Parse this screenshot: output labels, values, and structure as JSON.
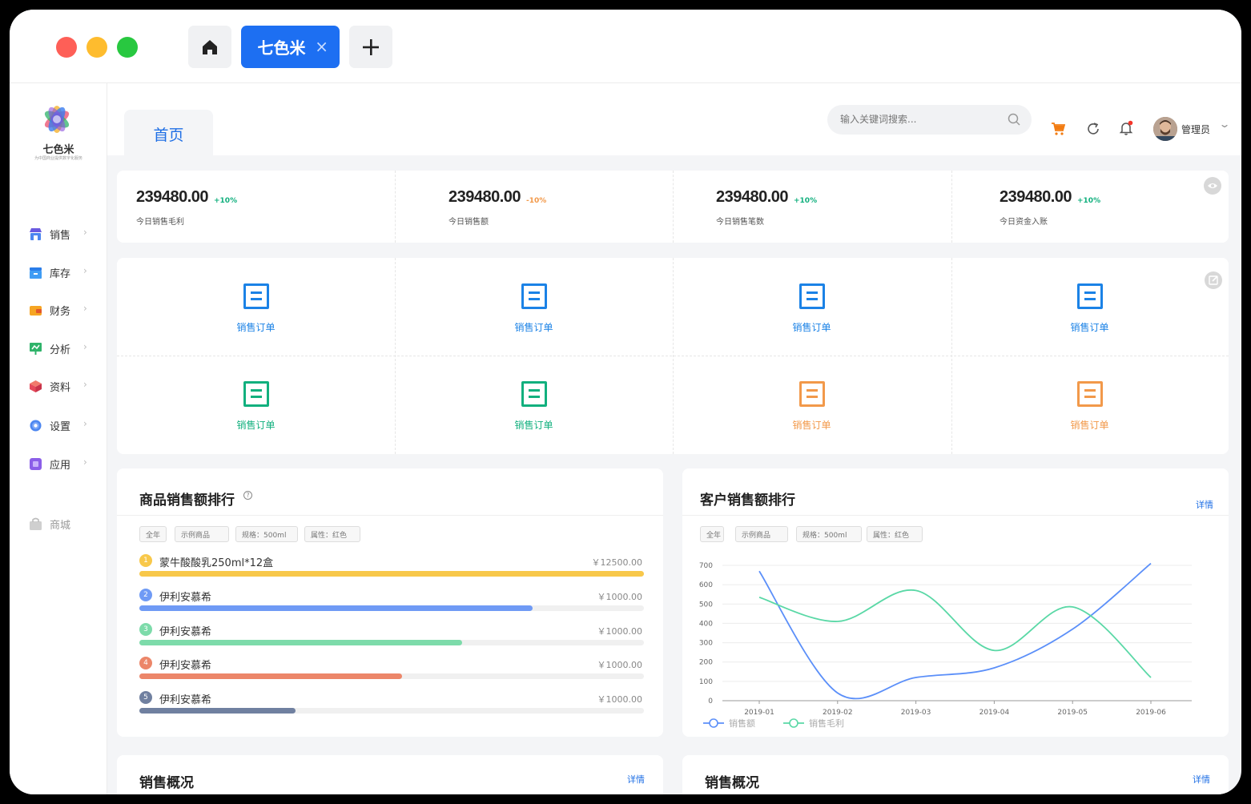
{
  "window": {
    "tabs": [
      {
        "label": "七色米"
      }
    ],
    "colors": {
      "accent": "#1d6ff2",
      "red": "#fe5f57",
      "yellow": "#febc2e",
      "green": "#28c840"
    }
  },
  "brand": {
    "name": "七色米",
    "slogan": "为中国商业提供数字化服务"
  },
  "sidebar": {
    "items": [
      {
        "label": "销售",
        "icon": "store-icon"
      },
      {
        "label": "库存",
        "icon": "box-icon"
      },
      {
        "label": "财务",
        "icon": "wallet-icon"
      },
      {
        "label": "分析",
        "icon": "chart-board-icon"
      },
      {
        "label": "资料",
        "icon": "cube-icon"
      },
      {
        "label": "设置",
        "icon": "gear-icon"
      },
      {
        "label": "应用",
        "icon": "app-icon"
      }
    ],
    "extra": {
      "label": "商城",
      "icon": "bag-icon"
    }
  },
  "header": {
    "page_tab": "首页",
    "search_placeholder": "输入关键词搜索...",
    "user": "管理员"
  },
  "stats": [
    {
      "value": "239480.00",
      "delta": "+10%",
      "trend": "up",
      "label": "今日销售毛利"
    },
    {
      "value": "239480.00",
      "delta": "-10%",
      "trend": "down",
      "label": "今日销售额"
    },
    {
      "value": "239480.00",
      "delta": "+10%",
      "trend": "up",
      "label": "今日销售笔数"
    },
    {
      "value": "239480.00",
      "delta": "+10%",
      "trend": "up",
      "label": "今日资金入账"
    }
  ],
  "quick": [
    {
      "label": "销售订单",
      "color": "#1b82e6"
    },
    {
      "label": "销售订单",
      "color": "#1b82e6"
    },
    {
      "label": "销售订单",
      "color": "#1b82e6"
    },
    {
      "label": "销售订单",
      "color": "#1b82e6"
    },
    {
      "label": "销售订单",
      "color": "#12b07e"
    },
    {
      "label": "销售订单",
      "color": "#12b07e"
    },
    {
      "label": "销售订单",
      "color": "#f2994a"
    },
    {
      "label": "销售订单",
      "color": "#f2994a"
    }
  ],
  "product_rank": {
    "title": "商品销售额排行",
    "filters": [
      "全年",
      "示例商品",
      "规格：500ml",
      "属性：红色"
    ],
    "rows": [
      {
        "rank": "1",
        "name": "蒙牛酸酸乳250ml*12盒",
        "value": "￥12500.00",
        "ratio": 1.0,
        "color": "#f8c84a"
      },
      {
        "rank": "2",
        "name": "伊利安慕希",
        "value": "￥1000.00",
        "ratio": 0.78,
        "color": "#6f9af5"
      },
      {
        "rank": "3",
        "name": "伊利安慕希",
        "value": "￥1000.00",
        "ratio": 0.64,
        "color": "#7ddbaa"
      },
      {
        "rank": "4",
        "name": "伊利安慕希",
        "value": "￥1000.00",
        "ratio": 0.52,
        "color": "#ec8669"
      },
      {
        "rank": "5",
        "name": "伊利安慕希",
        "value": "￥1000.00",
        "ratio": 0.31,
        "color": "#7080a0"
      }
    ]
  },
  "customer_rank": {
    "title": "客户销售额排行",
    "detail": "详情",
    "filters": [
      "全年",
      "示例商品",
      "规格：500ml",
      "属性：红色"
    ]
  },
  "chart_data": {
    "type": "line",
    "categories": [
      "2019-01",
      "2019-02",
      "2019-03",
      "2019-04",
      "2019-05",
      "2019-06"
    ],
    "ylim": [
      0,
      700
    ],
    "yticks": [
      0,
      100,
      200,
      300,
      400,
      500,
      600,
      700
    ],
    "grid": true,
    "legend_position": "bottom-left",
    "series": [
      {
        "name": "销售额",
        "color": "#5b8ff9",
        "values": [
          670,
          40,
          120,
          170,
          370,
          710
        ]
      },
      {
        "name": "销售毛利",
        "color": "#5ad8a6",
        "values": [
          535,
          410,
          570,
          260,
          485,
          120
        ]
      }
    ]
  },
  "bottom": [
    {
      "title": "销售概况",
      "detail": "详情"
    },
    {
      "title": "销售概况",
      "detail": "详情"
    }
  ]
}
